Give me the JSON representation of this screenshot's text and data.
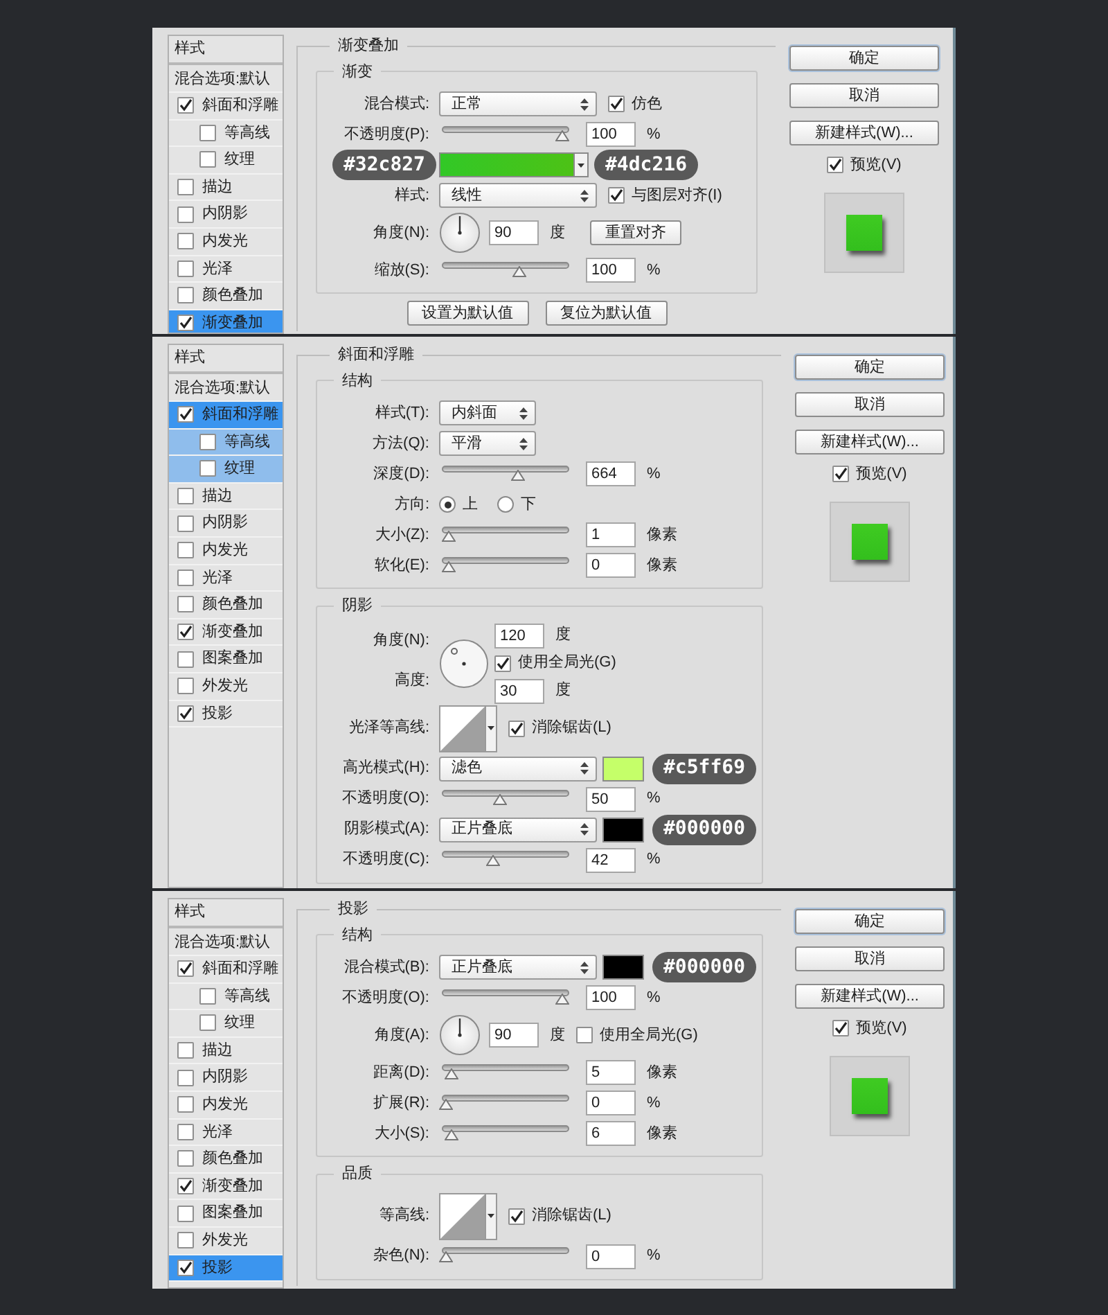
{
  "dialogs": [
    {
      "sidebar": {
        "header": "样式",
        "blend_options": "混合选项:默认",
        "items": [
          {
            "label": "斜面和浮雕",
            "checked": true,
            "selected": false,
            "children": [
              {
                "label": "等高线",
                "checked": false,
                "selected": false
              },
              {
                "label": "纹理",
                "checked": false,
                "selected": false
              }
            ]
          },
          {
            "label": "描边",
            "checked": false,
            "selected": false
          },
          {
            "label": "内阴影",
            "checked": false,
            "selected": false
          },
          {
            "label": "内发光",
            "checked": false,
            "selected": false
          },
          {
            "label": "光泽",
            "checked": false,
            "selected": false
          },
          {
            "label": "颜色叠加",
            "checked": false,
            "selected": false
          },
          {
            "label": "渐变叠加",
            "checked": true,
            "selected": true
          }
        ]
      },
      "section": {
        "title": "渐变叠加",
        "groups": [
          {
            "title": "渐变",
            "rows": [
              {
                "kind": "select",
                "label": "混合模式:",
                "value": "正常",
                "compact": false,
                "checkbox": {
                  "label": "仿色",
                  "checked": true
                }
              },
              {
                "kind": "slider",
                "label": "不透明度(P):",
                "level": 0.98,
                "value": "100",
                "unit": "%"
              },
              {
                "kind": "gradient",
                "badges": [
                  "#32c827",
                  "#4dc216"
                ]
              },
              {
                "kind": "select",
                "label": "样式:",
                "value": "线性",
                "compact": false,
                "checkbox": {
                  "label": "与图层对齐(I)",
                  "checked": true
                }
              },
              {
                "kind": "angle",
                "label": "角度(N):",
                "value": "90",
                "unit": "度",
                "button": "重置对齐"
              },
              {
                "kind": "slider",
                "label": "缩放(S):",
                "level": 0.62,
                "value": "100",
                "unit": "%"
              }
            ]
          }
        ],
        "footer_buttons": [
          "设置为默认值",
          "复位为默认值"
        ]
      },
      "actions": {
        "buttons": [
          {
            "label": "确定",
            "default": true
          },
          {
            "label": "取消",
            "default": false
          },
          {
            "label": "新建样式(W)...",
            "default": false
          }
        ],
        "preview": {
          "label": "预览(V)",
          "checked": true
        }
      }
    },
    {
      "sidebar": {
        "header": "样式",
        "blend_options": "混合选项:默认",
        "items": [
          {
            "label": "斜面和浮雕",
            "checked": true,
            "selected": true,
            "children": [
              {
                "label": "等高线",
                "checked": false,
                "selected": false
              },
              {
                "label": "纹理",
                "checked": false,
                "selected": false
              }
            ]
          },
          {
            "label": "描边",
            "checked": false,
            "selected": false
          },
          {
            "label": "内阴影",
            "checked": false,
            "selected": false
          },
          {
            "label": "内发光",
            "checked": false,
            "selected": false
          },
          {
            "label": "光泽",
            "checked": false,
            "selected": false
          },
          {
            "label": "颜色叠加",
            "checked": false,
            "selected": false
          },
          {
            "label": "渐变叠加",
            "checked": true,
            "selected": false
          },
          {
            "label": "图案叠加",
            "checked": false,
            "selected": false
          },
          {
            "label": "外发光",
            "checked": false,
            "selected": false
          },
          {
            "label": "投影",
            "checked": true,
            "selected": false
          }
        ]
      },
      "section": {
        "title": "斜面和浮雕",
        "groups": [
          {
            "title": "结构",
            "rows": [
              {
                "kind": "select",
                "label": "样式(T):",
                "value": "内斜面",
                "compact": true
              },
              {
                "kind": "select",
                "label": "方法(Q):",
                "value": "平滑",
                "compact": true
              },
              {
                "kind": "slider",
                "label": "深度(D):",
                "level": 0.6,
                "value": "664",
                "unit": "%"
              },
              {
                "kind": "radio",
                "label": "方向:",
                "options": [
                  {
                    "label": "上",
                    "selected": true
                  },
                  {
                    "label": "下",
                    "selected": false
                  }
                ]
              },
              {
                "kind": "slider",
                "label": "大小(Z):",
                "level": 0.02,
                "value": "1",
                "unit": "像素"
              },
              {
                "kind": "slider",
                "label": "软化(E):",
                "level": 0.02,
                "value": "0",
                "unit": "像素"
              }
            ]
          },
          {
            "title": "阴影",
            "rows": [
              {
                "kind": "shadow_angle",
                "label": "角度(N):",
                "value": "120",
                "unit": "度",
                "checkbox": {
                  "label": "使用全局光(G)",
                  "checked": true
                },
                "altitude_label": "高度:",
                "altitude_value": "30",
                "altitude_unit": "度"
              },
              {
                "kind": "contour",
                "label": "光泽等高线:",
                "checkbox": {
                  "label": "消除锯齿(L)",
                  "checked": true
                }
              },
              {
                "kind": "select",
                "label": "高光模式(H):",
                "value": "滤色",
                "compact": false,
                "badge": "#c5ff69"
              },
              {
                "kind": "slider",
                "label": "不透明度(O):",
                "level": 0.45,
                "value": "50",
                "unit": "%"
              },
              {
                "kind": "select",
                "label": "阴影模式(A):",
                "value": "正片叠底",
                "compact": false,
                "badge": "#000000"
              },
              {
                "kind": "slider",
                "label": "不透明度(C):",
                "level": 0.4,
                "value": "42",
                "unit": "%"
              }
            ]
          }
        ]
      },
      "actions": {
        "buttons": [
          {
            "label": "确定",
            "default": true
          },
          {
            "label": "取消",
            "default": false
          },
          {
            "label": "新建样式(W)...",
            "default": false
          }
        ],
        "preview": {
          "label": "预览(V)",
          "checked": true
        }
      }
    },
    {
      "sidebar": {
        "header": "样式",
        "blend_options": "混合选项:默认",
        "items": [
          {
            "label": "斜面和浮雕",
            "checked": true,
            "selected": false,
            "children": [
              {
                "label": "等高线",
                "checked": false,
                "selected": false
              },
              {
                "label": "纹理",
                "checked": false,
                "selected": false
              }
            ]
          },
          {
            "label": "描边",
            "checked": false,
            "selected": false
          },
          {
            "label": "内阴影",
            "checked": false,
            "selected": false
          },
          {
            "label": "内发光",
            "checked": false,
            "selected": false
          },
          {
            "label": "光泽",
            "checked": false,
            "selected": false
          },
          {
            "label": "颜色叠加",
            "checked": false,
            "selected": false
          },
          {
            "label": "渐变叠加",
            "checked": true,
            "selected": false
          },
          {
            "label": "图案叠加",
            "checked": false,
            "selected": false
          },
          {
            "label": "外发光",
            "checked": false,
            "selected": false
          },
          {
            "label": "投影",
            "checked": true,
            "selected": true
          }
        ]
      },
      "section": {
        "title": "投影",
        "groups": [
          {
            "title": "结构",
            "rows": [
              {
                "kind": "select",
                "label": "混合模式(B):",
                "value": "正片叠底",
                "compact": false,
                "badge": "#000000"
              },
              {
                "kind": "slider",
                "label": "不透明度(O):",
                "level": 0.98,
                "value": "100",
                "unit": "%"
              },
              {
                "kind": "angle",
                "label": "角度(A):",
                "value": "90",
                "unit": "度",
                "checkbox": {
                  "label": "使用全局光(G)",
                  "checked": false
                }
              },
              {
                "kind": "slider",
                "label": "距离(D):",
                "level": 0.05,
                "value": "5",
                "unit": "像素"
              },
              {
                "kind": "slider",
                "label": "扩展(R):",
                "level": 0.0,
                "value": "0",
                "unit": "%"
              },
              {
                "kind": "slider",
                "label": "大小(S):",
                "level": 0.05,
                "value": "6",
                "unit": "像素"
              }
            ]
          },
          {
            "title": "品质",
            "rows": [
              {
                "kind": "contour",
                "label": "等高线:",
                "checkbox": {
                  "label": "消除锯齿(L)",
                  "checked": true
                }
              },
              {
                "kind": "slider",
                "label": "杂色(N):",
                "level": 0.0,
                "value": "0",
                "unit": "%"
              }
            ]
          }
        ]
      },
      "actions": {
        "buttons": [
          {
            "label": "确定",
            "default": true
          },
          {
            "label": "取消",
            "default": false
          },
          {
            "label": "新建样式(W)...",
            "default": false
          }
        ],
        "preview": {
          "label": "预览(V)",
          "checked": true
        }
      }
    }
  ]
}
